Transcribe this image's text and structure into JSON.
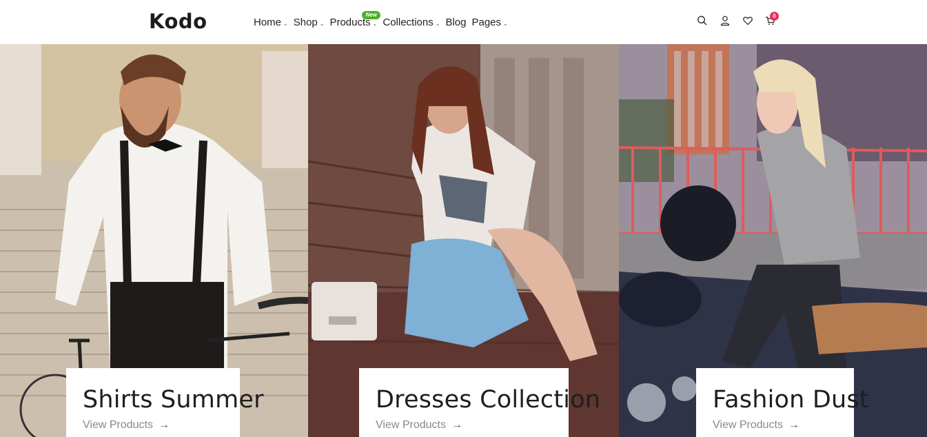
{
  "brand": {
    "logo": "Kodo"
  },
  "nav": {
    "items": [
      {
        "label": "Home",
        "chevron": "⌄"
      },
      {
        "label": "Shop",
        "chevron": "⌄"
      },
      {
        "label": "Products",
        "chevron": "⌄",
        "badge": "New"
      },
      {
        "label": "Collections",
        "chevron": "⌄"
      },
      {
        "label": "Blog",
        "chevron": ""
      },
      {
        "label": "Pages",
        "chevron": "⌄"
      }
    ]
  },
  "header_icons": {
    "search": "search-icon",
    "account": "user-icon",
    "wishlist": "heart-icon",
    "cart": "cart-icon",
    "cart_count": "0"
  },
  "colors": {
    "badge_new": "#4caf28",
    "cart_badge": "#e8315b"
  },
  "panels": [
    {
      "title": "Shirts Summer",
      "link": "View Products",
      "arrow": "→"
    },
    {
      "title": "Dresses Collection",
      "link": "View Products",
      "arrow": "→"
    },
    {
      "title": "Fashion Dust",
      "link": "View Products",
      "arrow": "→"
    }
  ]
}
